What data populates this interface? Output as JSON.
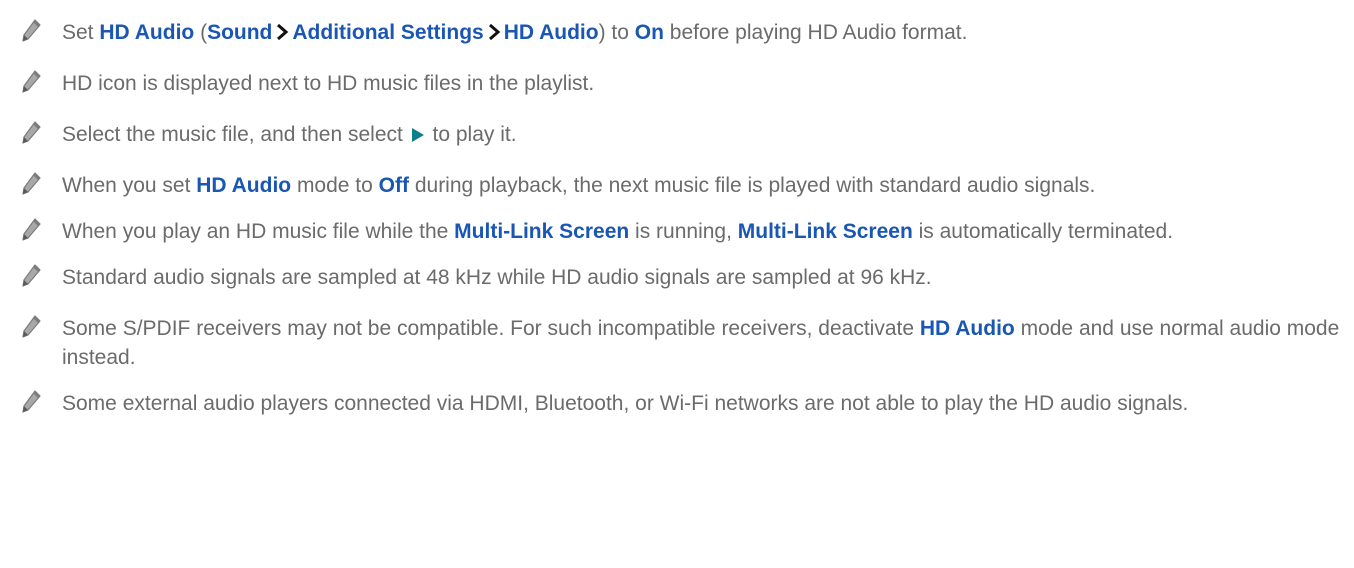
{
  "colors": {
    "text": "#6b6b6b",
    "keyword": "#1a56b3",
    "icon": "#8e8e8e",
    "play": "#0f7f8c"
  },
  "icons": {
    "bullet": "pencil-icon",
    "path_separator": "chevron-right-icon",
    "play": "play-icon"
  },
  "notes": [
    {
      "t1": "Set ",
      "k1": "HD Audio",
      "t2": " (",
      "k2": "Sound",
      "k3": "Additional Settings",
      "k4": "HD Audio",
      "t3": ") to ",
      "k5": "On",
      "t4": " before playing HD Audio format."
    },
    {
      "text": "HD icon is displayed next to HD music files in the playlist."
    },
    {
      "t1": "Select the music file, and then select ",
      "t2": " to play it."
    },
    {
      "t1": "When you set ",
      "k1": "HD Audio",
      "t2": " mode to ",
      "k2": "Off",
      "t3": " during playback, the next music file is played with standard audio signals."
    },
    {
      "t1": "When you play an HD music file while the ",
      "k1": "Multi-Link Screen",
      "t2": " is running, ",
      "k2": "Multi-Link Screen",
      "t3": " is automatically terminated."
    },
    {
      "text": "Standard audio signals are sampled at 48 kHz while HD audio signals are sampled at 96 kHz."
    },
    {
      "t1": "Some S/PDIF receivers may not be compatible. For such incompatible receivers, deactivate ",
      "k1": "HD Audio",
      "t2": " mode and use normal audio mode instead."
    },
    {
      "text": "Some external audio players connected via HDMI, Bluetooth, or Wi-Fi networks are not able to play the HD audio signals."
    }
  ]
}
